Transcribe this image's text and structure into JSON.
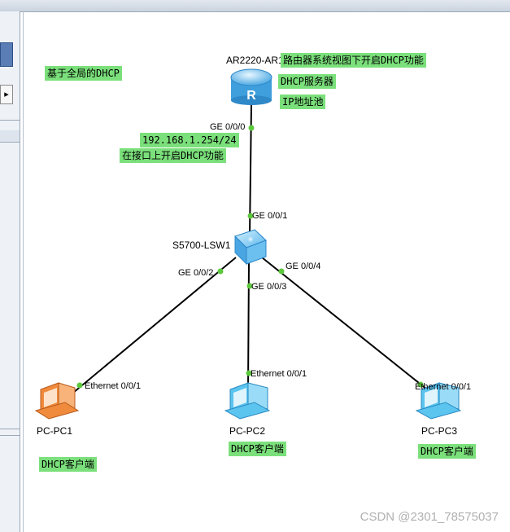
{
  "devices": {
    "router": {
      "name": "AR2220-AR1",
      "icon": "router-icon"
    },
    "switch": {
      "name": "S5700-LSW1",
      "icon": "switch-icon"
    },
    "pc1": {
      "name": "PC-PC1",
      "icon": "pc-icon",
      "color": "#f08a3c"
    },
    "pc2": {
      "name": "PC-PC2",
      "icon": "pc-icon",
      "color": "#5bc4ef"
    },
    "pc3": {
      "name": "PC-PC3",
      "icon": "pc-icon",
      "color": "#5bc4ef"
    }
  },
  "ports": {
    "router_ge000": "GE 0/0/0",
    "switch_ge001": "GE 0/0/1",
    "switch_ge002": "GE 0/0/2",
    "switch_ge003": "GE 0/0/3",
    "switch_ge004": "GE 0/0/4",
    "pc1_eth": "Ethernet 0/0/1",
    "pc2_eth": "Ethernet 0/0/1",
    "pc3_eth": "Ethernet 0/0/1"
  },
  "notes": {
    "global_dhcp": "基于全局的DHCP",
    "router_enable": "路由器系统视图下开启DHCP功能",
    "dhcp_server": "DHCP服务器",
    "ip_pool": "IP地址池",
    "interface_ip": "192.168.1.254/24",
    "interface_enable": "在接口上开启DHCP功能",
    "client1": "DHCP客户端",
    "client2": "DHCP客户端",
    "client3": "DHCP客户端"
  },
  "watermark": "CSDN @2301_78575037",
  "colors": {
    "note_bg": "#7be07b",
    "port_dot": "#5cc83c",
    "link": "#000000"
  }
}
